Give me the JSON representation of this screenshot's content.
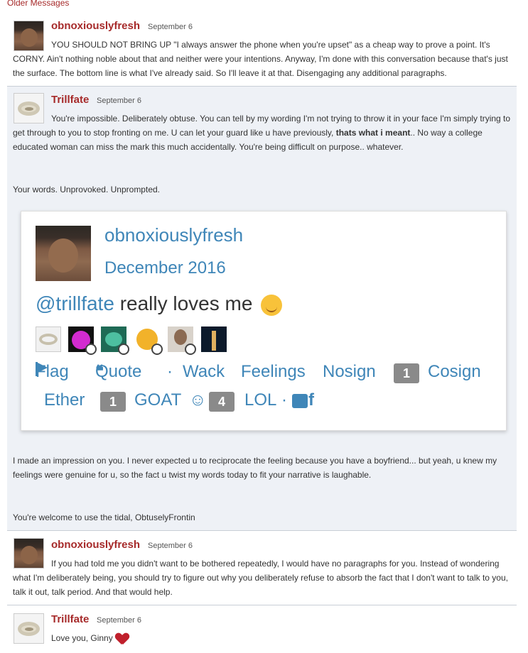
{
  "older_messages_link": "Older Messages",
  "messages": [
    {
      "user": "obnoxiouslyfresh",
      "date": "September 6",
      "text": "YOU SHOULD NOT BRING UP \"I always answer the phone when you're upset\" as a cheap way to prove a point. It's CORNY. Ain't nothing noble about that and neither were your intentions. Anyway, I'm done with this conversation because that's just the surface. The bottom line is what I've already said. So I'll leave it at that. Disengaging any additional paragraphs."
    },
    {
      "user": "Trillfate",
      "date": "September 6",
      "text_before_bold": "You're impossible. Deliberately obtuse. You can tell by my wording I'm not trying to throw it in your face I'm simply trying to get through to you to stop fronting on me. U can let your guard like u have previously,",
      "text_bold": "thats what i meant",
      "text_after_bold": ".. No way a college educated woman can miss the mark this much accidentally. You're being difficult on purpose.. whatever.",
      "para2": "Your words. Unprovoked. Unprompted.",
      "para3": "I made an impression on you. I never expected u to reciprocate the feeling because you have a boyfriend... but yeah, u knew my feelings were genuine for u, so the fact u twist my words today to fit your narrative is laughable.",
      "para4": "You're welcome to use the tidal, ObtuselyFrontin"
    },
    {
      "user": "obnoxiouslyfresh",
      "date": "September 6",
      "text": "If you had told me you didn't want to be bothered repeatedly, I would have no paragraphs for you. Instead of wondering what I'm deliberately being, you should try to figure out why you deliberately refuse to absorb the fact that I don't want to talk to you, talk it out, talk period. And that would help."
    },
    {
      "user": "Trillfate",
      "date": "September 6",
      "text": "Love you, Ginny"
    }
  ],
  "embed": {
    "user": "obnoxiouslyfresh",
    "date": "December 2016",
    "mention": "@trillfate",
    "line_rest": "really loves me",
    "actions": {
      "flag": "Flag",
      "quote": "Quote",
      "sep1": "·",
      "wack": "Wack",
      "feelings": "Feelings",
      "nosign": "Nosign",
      "cosign_count": "1",
      "cosign": "Cosign",
      "ether": "Ether",
      "goat_count": "1",
      "goat": "GOAT",
      "lol_count": "4",
      "lol": "LOL",
      "sep2": "·",
      "fb": "f"
    }
  },
  "colors": {
    "username": "#a62a2a",
    "embed_link": "#3f86b8",
    "alt_background": "#eef1f6"
  }
}
